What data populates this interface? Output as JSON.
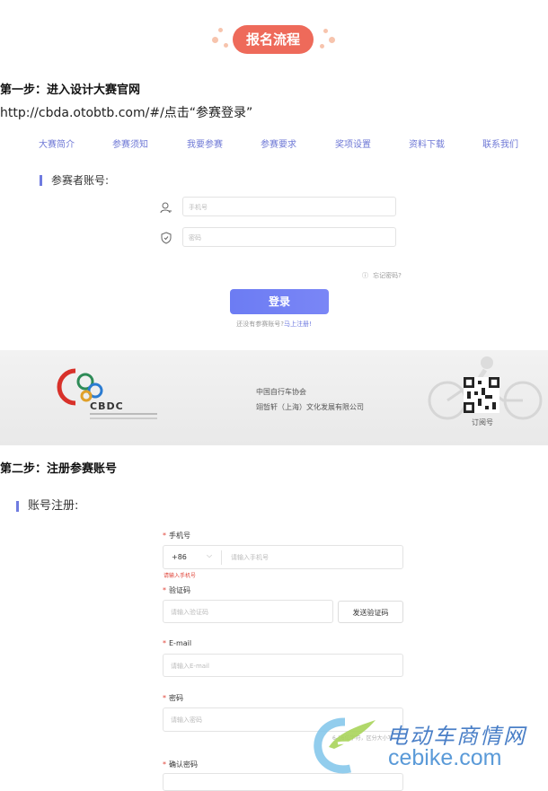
{
  "header": {
    "title": "报名流程"
  },
  "step1": {
    "title": "第一步：进入设计大赛官网",
    "instruction": "http://cbda.otobtb.com/#/点击“参赛登录”"
  },
  "nav": {
    "items": [
      "大赛简介",
      "参赛须知",
      "我要参赛",
      "参赛要求",
      "奖项设置",
      "资料下载",
      "联系我们"
    ]
  },
  "login": {
    "section_title": "参赛者账号:",
    "phone_placeholder": "手机号",
    "password_placeholder": "密码",
    "forgot": "忘记密码?",
    "button": "登录",
    "register_prompt": "还没有参赛账号?",
    "register_link": "马上注册!"
  },
  "footer_band": {
    "logo_text": "CBDC",
    "org1": "中国自行车协会",
    "org2": "翊晢轩（上海）文化发展有限公司",
    "qr_label": "订阅号"
  },
  "step2": {
    "title": "第二步：注册参赛账号"
  },
  "register": {
    "section_title": "账号注册:",
    "phone_label": "手机号",
    "country_code": "+86",
    "phone_placeholder": "请输入手机号",
    "phone_error": "请输入手机号",
    "code_label": "验证码",
    "code_placeholder": "请输入验证码",
    "send_code": "发送验证码",
    "email_label": "E-mail",
    "email_placeholder": "请输入E-mail",
    "password_label": "密码",
    "password_placeholder": "请输入密码",
    "password_hint": "6-16位字符，区分大小写",
    "confirm_label": "确认密码"
  },
  "watermark": {
    "cn": "电动车商情网",
    "en": "cebike.com"
  },
  "colors": {
    "accent": "#6f7be0",
    "pill": "#ee6a5a",
    "error": "#e0453a"
  }
}
